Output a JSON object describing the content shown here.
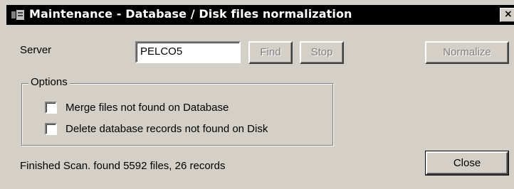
{
  "window": {
    "title": "Maintenance - Database / Disk files normalization",
    "close_glyph": "×"
  },
  "server": {
    "label": "Server",
    "value": "PELCO5"
  },
  "buttons": {
    "find": "Find",
    "stop": "Stop",
    "normalize": "Normalize",
    "close": "Close"
  },
  "options": {
    "title": "Options",
    "merge_label": "Merge files not found on Database",
    "merge_checked": false,
    "delete_label": "Delete database records not found on Disk",
    "delete_checked": false
  },
  "status": {
    "text": "Finished Scan. found 5592 files, 26 records"
  },
  "colors": {
    "face": "#d4d0c8",
    "titlebar": "#000000",
    "disabled_text": "#808080"
  }
}
